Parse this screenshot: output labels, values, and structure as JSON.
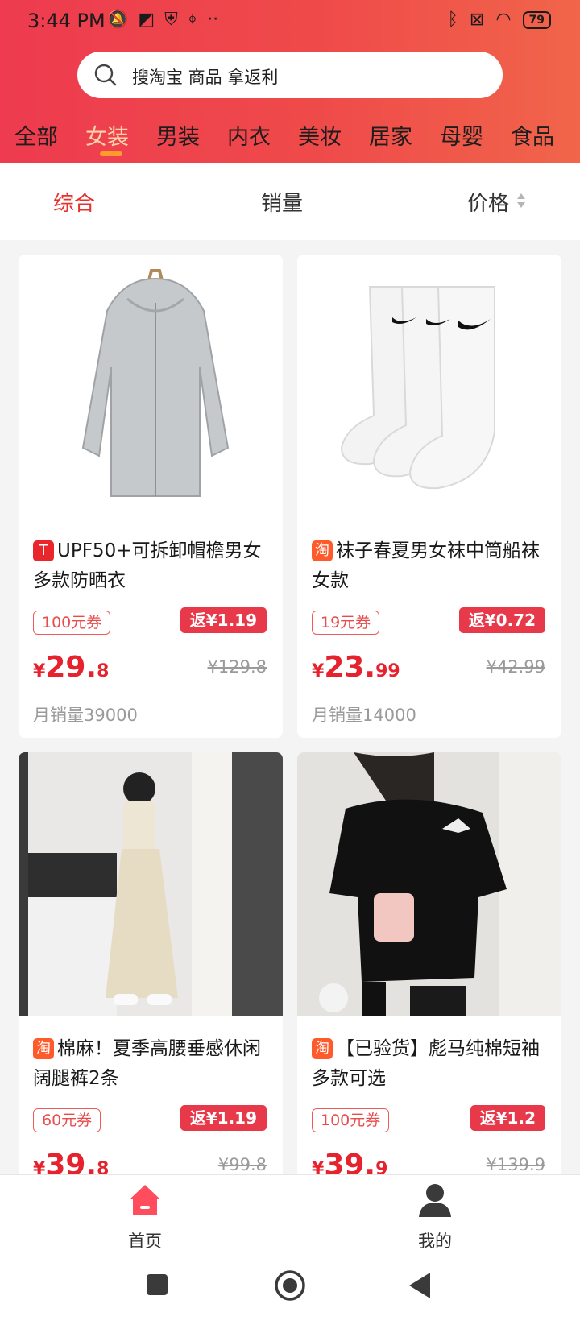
{
  "status": {
    "time": "3:44 PM",
    "battery": "79"
  },
  "search": {
    "placeholder": "搜淘宝 商品 拿返利"
  },
  "categories": [
    "全部",
    "女装",
    "男装",
    "内衣",
    "美妆",
    "居家",
    "母婴",
    "食品"
  ],
  "active_category": "女装",
  "sort": {
    "comprehensive": "综合",
    "sales": "销量",
    "price": "价格"
  },
  "products": [
    {
      "badge": "T",
      "title": "UPF50+可拆卸帽檐男女多款防晒衣",
      "coupon": "100元券",
      "rebate": "返¥1.19",
      "price_symbol": "¥",
      "price_int": "29.",
      "price_dec": "8",
      "original_price": "¥129.8",
      "sales": "月销量39000"
    },
    {
      "badge": "淘",
      "title": "袜子春夏男女袜中筒船袜女款",
      "coupon": "19元券",
      "rebate": "返¥0.72",
      "price_symbol": "¥",
      "price_int": "23.",
      "price_dec": "99",
      "original_price": "¥42.99",
      "sales": "月销量14000"
    },
    {
      "badge": "淘",
      "title": "棉麻！夏季高腰垂感休闲阔腿裤2条",
      "coupon": "60元券",
      "rebate": "返¥1.19",
      "price_symbol": "¥",
      "price_int": "39.",
      "price_dec": "8",
      "original_price": "¥99.8"
    },
    {
      "badge": "淘",
      "title": "【已验货】彪马纯棉短袖多款可选",
      "coupon": "100元券",
      "rebate": "返¥1.2",
      "price_symbol": "¥",
      "price_int": "39.",
      "price_dec": "9",
      "original_price": "¥139.9"
    }
  ],
  "bottom_nav": {
    "home": "首页",
    "mine": "我的"
  },
  "colors": {
    "brand_red": "#ee3b4f",
    "price_red": "#e5222d",
    "active_tab": "#ffd3a8",
    "nav_active": "#ff4d5e"
  }
}
